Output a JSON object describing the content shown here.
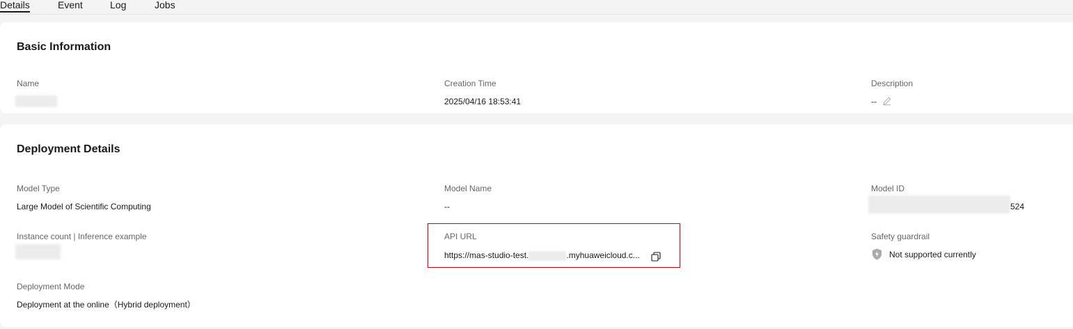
{
  "tabs": [
    {
      "label": "Details",
      "active": true
    },
    {
      "label": "Event",
      "active": false
    },
    {
      "label": "Log",
      "active": false
    },
    {
      "label": "Jobs",
      "active": false
    }
  ],
  "basic": {
    "title": "Basic Information",
    "name_label": "Name",
    "creation_time_label": "Creation Time",
    "creation_time_value": "2025/04/16 18:53:41",
    "description_label": "Description",
    "description_value": "--",
    "edit_icon": "edit-pencil-icon"
  },
  "deployment": {
    "title": "Deployment Details",
    "model_type_label": "Model Type",
    "model_type_value": "Large Model of Scientific Computing",
    "model_name_label": "Model Name",
    "model_name_value": "--",
    "model_id_label": "Model ID",
    "model_id_suffix": "524",
    "instance_label": "Instance count | Inference example",
    "api_url_label": "API URL",
    "api_url_prefix": "https://mas-studio-test.",
    "api_url_suffix": ".myhuaweicloud.c...",
    "copy_icon": "copy-icon",
    "safety_label": "Safety guardrail",
    "safety_icon": "shield-icon",
    "safety_value": "Not supported currently",
    "deploy_mode_label": "Deployment Mode",
    "deploy_mode_value": "Deployment at the online（Hybrid deployment）"
  },
  "colors": {
    "highlight_border": "#c7000b",
    "label": "#666666",
    "text": "#191919"
  }
}
